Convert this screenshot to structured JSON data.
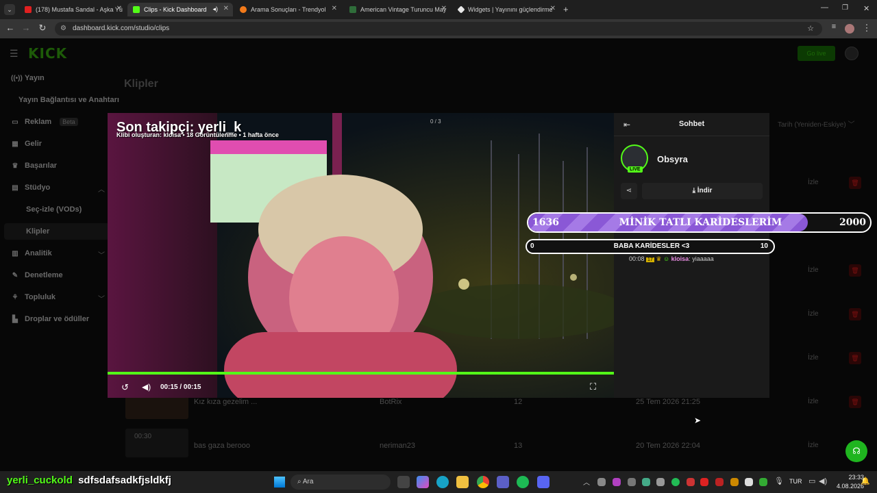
{
  "browser": {
    "tabs": [
      {
        "title": "(178) Mustafa Sandal - Aşka Yü",
        "color": "#e02020"
      },
      {
        "title": "Clips - Kick Dashboard",
        "color": "#53fc18"
      },
      {
        "title": "Arama Sonuçları - Trendyol",
        "color": "#f27a1a"
      },
      {
        "title": "American Vintage Turuncu May",
        "color": "#2f6d3a"
      },
      {
        "title": "Widgets | Yayınını güçlendirme",
        "color": "#e8e8e8"
      }
    ],
    "url": "dashboard.kick.com/studio/clips"
  },
  "dashboard": {
    "logo": "KICK",
    "go_live": "Go live",
    "page_title": "Klipler",
    "sort_label": "Tarih (Yeniden-Eskiye)",
    "sidebar": [
      {
        "label": "Yayın",
        "icon": "broadcast-icon"
      },
      {
        "label": "Yayın Bağlantısı ve Anahtarı",
        "icon": ""
      },
      {
        "label": "Reklam",
        "icon": "ad-icon",
        "badge": "Beta"
      },
      {
        "label": "Gelir",
        "icon": "revenue-icon"
      },
      {
        "label": "Başarılar",
        "icon": "trophy-icon"
      },
      {
        "label": "Stüdyo",
        "icon": "studio-icon"
      },
      {
        "label": "Seç-izle (VODs)",
        "icon": ""
      },
      {
        "label": "Klipler",
        "icon": ""
      },
      {
        "label": "Analitik",
        "icon": "analytics-icon"
      },
      {
        "label": "Denetleme",
        "icon": "wrench-icon"
      },
      {
        "label": "Topluluk",
        "icon": "community-icon"
      },
      {
        "label": "Droplar ve ödüller",
        "icon": "drops-icon"
      }
    ],
    "clips": [
      {
        "title": "Kız kıza gezelim ...",
        "author": "BotRix",
        "views": "12",
        "date": "25 Tem 2026 21:25",
        "duration": ""
      },
      {
        "title": "bas gaza berooo",
        "author": "neriman23",
        "views": "13",
        "date": "20 Tem 2026 22:04",
        "duration": "00:30"
      }
    ],
    "watch_label": "İzle"
  },
  "video": {
    "overlay_follower": "Son takipçi: yerli_k",
    "clip_info": "Klibi oluşturan: kloisa • 18 Görüntülenme • 1 hafta önce",
    "counter": "0 / 3",
    "time": "00:15 / 00:15",
    "progress": 1.0
  },
  "chat": {
    "title": "Sohbet",
    "streamer": "Obsyra",
    "live_badge": "LIVE",
    "download_label": "İndir",
    "message": {
      "time": "00:08",
      "badge": "17",
      "user": "kloisa",
      "text": "yiaaaaa"
    }
  },
  "goal_bar_1": {
    "current": "1636",
    "label": "MİNİK TATLI KARİDESLERİM",
    "target": "2000",
    "fraction": 0.818
  },
  "goal_bar_2": {
    "current": "0",
    "label": "BABA KARİDESLER <3",
    "target": "10",
    "fraction": 0.0
  },
  "ticker": {
    "user": "yerli_cuckold",
    "message": "sdfsdafsadkfjsldkfj"
  },
  "taskbar": {
    "search": "Ara",
    "language": "TUR",
    "time": "23:33",
    "date": "4.08.2026"
  },
  "colors": {
    "kick_green": "#53fc18",
    "goal_purple": "#8a58d6"
  }
}
